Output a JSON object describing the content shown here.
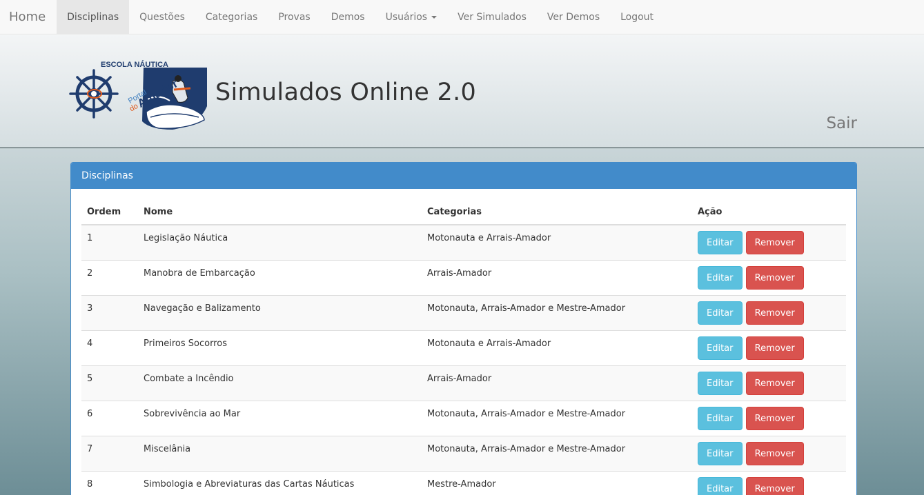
{
  "navbar": {
    "brand": "Home",
    "items": [
      {
        "label": "Disciplinas",
        "active": true
      },
      {
        "label": "Questões"
      },
      {
        "label": "Categorias"
      },
      {
        "label": "Provas"
      },
      {
        "label": "Demos"
      },
      {
        "label": "Usuários",
        "dropdown": true
      },
      {
        "label": "Ver Simulados"
      },
      {
        "label": "Ver Demos"
      },
      {
        "label": "Logout"
      }
    ]
  },
  "header": {
    "logo": {
      "top_text": "ESCOLA NÁUTICA",
      "portal": "Portal",
      "do": "do",
      "amador": "Amador"
    },
    "title": "Simulados Online 2.0",
    "sair": "Sair"
  },
  "panel": {
    "title": "Disciplinas",
    "columns": [
      "Ordem",
      "Nome",
      "Categorias",
      "Ação"
    ],
    "edit_label": "Editar",
    "remove_label": "Remover",
    "rows": [
      {
        "ordem": "1",
        "nome": "Legislação Náutica",
        "categorias": "Motonauta e Arrais-Amador"
      },
      {
        "ordem": "2",
        "nome": "Manobra de Embarcação",
        "categorias": "Arrais-Amador"
      },
      {
        "ordem": "3",
        "nome": "Navegação e Balizamento",
        "categorias": "Motonauta, Arrais-Amador e Mestre-Amador"
      },
      {
        "ordem": "4",
        "nome": "Primeiros Socorros",
        "categorias": "Motonauta e Arrais-Amador"
      },
      {
        "ordem": "5",
        "nome": "Combate a Incêndio",
        "categorias": "Arrais-Amador"
      },
      {
        "ordem": "6",
        "nome": "Sobrevivência ao Mar",
        "categorias": "Motonauta, Arrais-Amador e Mestre-Amador"
      },
      {
        "ordem": "7",
        "nome": "Miscelânia",
        "categorias": "Motonauta, Arrais-Amador e Mestre-Amador"
      },
      {
        "ordem": "8",
        "nome": "Simbologia e Abreviaturas das Cartas Náuticas",
        "categorias": "Mestre-Amador"
      }
    ]
  },
  "colors": {
    "primary": "#428bca",
    "info": "#5bc0de",
    "danger": "#d9534f"
  }
}
